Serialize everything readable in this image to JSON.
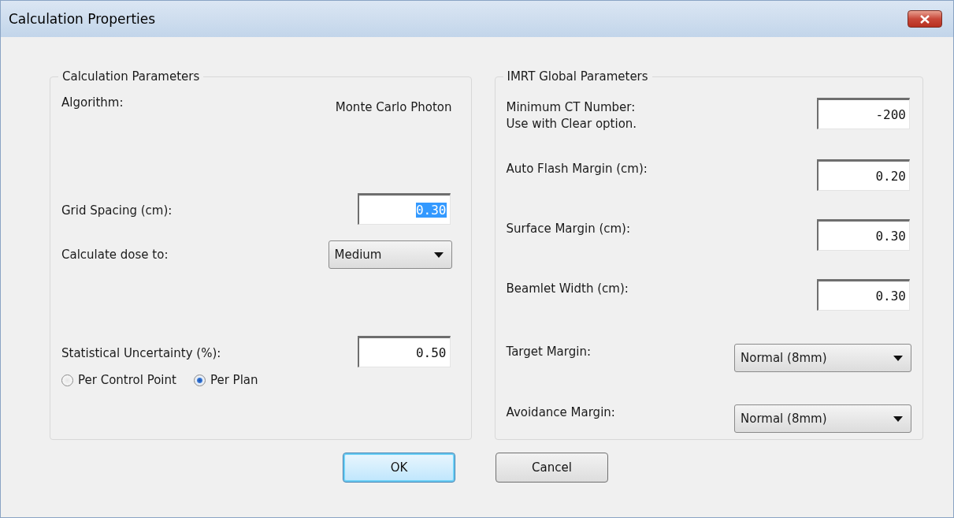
{
  "window": {
    "title": "Calculation Properties"
  },
  "left_group": {
    "title": "Calculation Parameters",
    "rows": [
      {
        "kind": "text",
        "label": "Algorithm:",
        "value": "Monte Carlo Photon"
      },
      {
        "kind": "field",
        "label": "Grid Spacing (cm):",
        "value": "0.30",
        "text_selected": true
      },
      {
        "kind": "dropdown",
        "label": "Calculate dose to:",
        "value": "Medium"
      },
      {
        "kind": "field",
        "label": "Statistical Uncertainty (%):",
        "value": "0.50",
        "text_selected": false
      },
      {
        "kind": "radios",
        "options": [
          {
            "label": "Per Control Point",
            "selected": false
          },
          {
            "label": "Per Plan",
            "selected": true
          }
        ]
      }
    ]
  },
  "right_group": {
    "title": "IMRT Global Parameters",
    "rows": [
      {
        "kind": "field",
        "label": "Minimum CT Number:",
        "note": "Use with Clear option.",
        "value": "-200",
        "text_selected": false
      },
      {
        "kind": "field",
        "label": "Auto Flash Margin (cm):",
        "value": "0.20",
        "text_selected": false
      },
      {
        "kind": "field",
        "label": "Surface Margin (cm):",
        "value": "0.30",
        "text_selected": false
      },
      {
        "kind": "field",
        "label": "Beamlet Width (cm):",
        "value": "0.30",
        "text_selected": false
      },
      {
        "kind": "dropdown",
        "label": "Target Margin:",
        "value": "Normal (8mm)"
      },
      {
        "kind": "dropdown",
        "label": "Avoidance Margin:",
        "value": "Normal (8mm)"
      }
    ]
  },
  "buttons": [
    {
      "label": "OK",
      "default": true
    },
    {
      "label": "Cancel",
      "default": false
    }
  ]
}
